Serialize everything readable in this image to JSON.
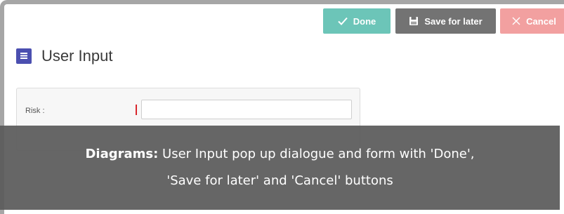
{
  "toolbar": {
    "done_label": "Done",
    "save_label": "Save for later",
    "cancel_label": "Cancel",
    "done_icon": "check-icon",
    "save_icon": "save-icon",
    "cancel_icon": "close-icon"
  },
  "header": {
    "title": "User Input",
    "icon": "form-list-icon",
    "icon_color": "#4b4fb0"
  },
  "form": {
    "fields": [
      {
        "label": "Risk :",
        "value": "",
        "required": true
      }
    ]
  },
  "caption": {
    "bold": "Diagrams:",
    "line1": "User Input pop up dialogue and form with 'Done',",
    "line2": "'Save for later' and 'Cancel' buttons"
  },
  "colors": {
    "done": "#6cc5b8",
    "save": "#737373",
    "cancel": "#f2a0a0",
    "required": "#d9262c"
  }
}
